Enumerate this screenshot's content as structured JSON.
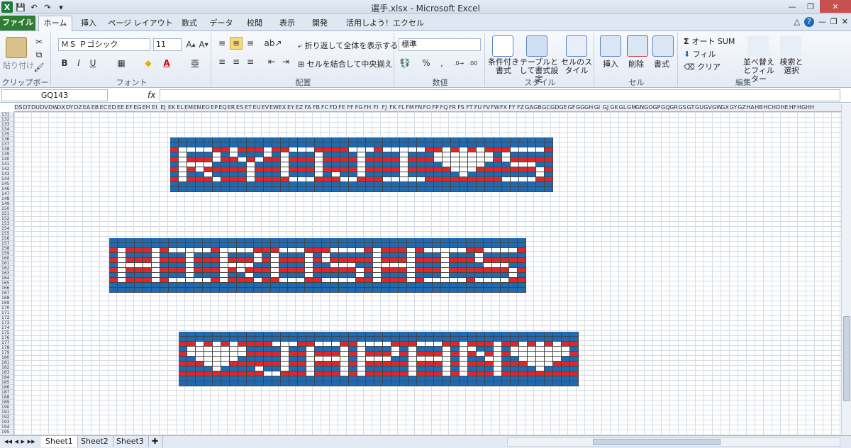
{
  "window": {
    "title": "選手.xlsx - Microsoft Excel"
  },
  "qat": {
    "save": "save-icon",
    "undo": "undo-icon",
    "redo": "redo-icon"
  },
  "tabs": [
    "ファイル",
    "ホーム",
    "挿入",
    "ページ レイアウト",
    "数式",
    "データ",
    "校閲",
    "表示",
    "開発",
    "活用しよう！エクセル"
  ],
  "ribbon": {
    "clipboard": {
      "paste": "貼り付け",
      "label": "クリップボード"
    },
    "font": {
      "name": "ＭＳ Ｐゴシック",
      "size": "11",
      "bold": "B",
      "italic": "I",
      "underline": "U",
      "label": "フォント"
    },
    "alignment": {
      "wrap": "折り返して全体を表示する",
      "merge": "セルを結合して中央揃え",
      "label": "配置"
    },
    "number": {
      "format": "標準",
      "label": "数値"
    },
    "styles": {
      "conditional": "条件付き書式",
      "table": "テーブルとして書式設定",
      "cell": "セルのスタイル",
      "label": "スタイル"
    },
    "cells": {
      "insert": "挿入",
      "delete": "削除",
      "format": "書式",
      "label": "セル"
    },
    "editing": {
      "autosum": "オート SUM",
      "fill": "フィル",
      "clear": "クリア",
      "sort": "並べ替えとフィルター",
      "find": "検索と選択",
      "label": "編集"
    }
  },
  "formula": {
    "namebox": "GQ143",
    "fx": "fx",
    "value": ""
  },
  "columns": [
    "DS",
    "DT",
    "DU",
    "DV",
    "DW",
    "DX",
    "DY",
    "DZ",
    "EA",
    "EB",
    "EC",
    "ED",
    "EE",
    "EF",
    "EG",
    "EH",
    "EI",
    "EJ",
    "EK",
    "EL",
    "EM",
    "EN",
    "EO",
    "EP",
    "EQ",
    "ER",
    "ES",
    "ET",
    "EU",
    "EV",
    "EW",
    "EX",
    "EY",
    "EZ",
    "FA",
    "FB",
    "FC",
    "FD",
    "FE",
    "FF",
    "FG",
    "FH",
    "FI",
    "FJ",
    "FK",
    "FL",
    "FM",
    "FN",
    "FO",
    "FP",
    "FQ",
    "FR",
    "FS",
    "FT",
    "FU",
    "FV",
    "FW",
    "FX",
    "FY",
    "FZ",
    "GA",
    "GB",
    "GC",
    "GD",
    "GE",
    "GF",
    "GG",
    "GH",
    "GI",
    "GJ",
    "GK",
    "GL",
    "GM",
    "GN",
    "GO",
    "GP",
    "GQ",
    "GR",
    "GS",
    "GT",
    "GU",
    "GV",
    "GW",
    "GX",
    "GY",
    "GZ",
    "HA",
    "HB",
    "HC",
    "HD",
    "HE",
    "HF",
    "HG",
    "HH"
  ],
  "row_start": 131,
  "row_end": 195,
  "colors": {
    "blue": "#1e6bb5",
    "red": "#e02626",
    "white": "#ffffff",
    "grid_line": "#444444"
  },
  "banners": [
    {
      "text": "RYOJI♥S"
    },
    {
      "text": "HIROSHIS"
    },
    {
      "text": "♥JAPAN♥"
    }
  ],
  "sheets": [
    "Sheet1",
    "Sheet2",
    "Sheet3"
  ]
}
